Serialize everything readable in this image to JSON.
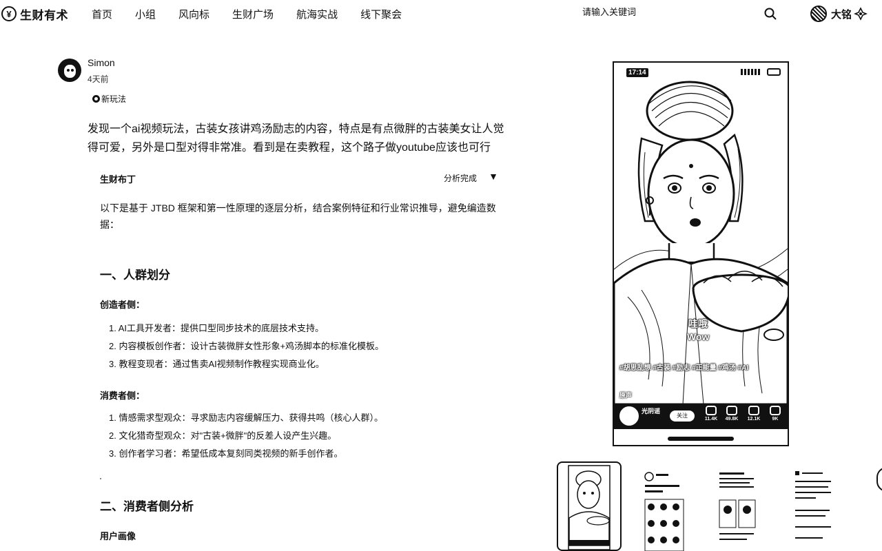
{
  "brand": {
    "logo_mark": "¥",
    "name": "生财有术"
  },
  "nav": {
    "items": [
      "首页",
      "小组",
      "风向标",
      "生财广场",
      "航海实战",
      "线下聚会"
    ]
  },
  "search": {
    "placeholder": "请输入关键词",
    "icon": "search-icon"
  },
  "user": {
    "name": "大铭",
    "avatar_icon": "user-avatar",
    "badge_icon": "brand-logo-icon"
  },
  "post": {
    "author": "Simon",
    "time": "4天前",
    "tag": "新玩法",
    "body": "发现一个ai视频玩法，古装女孩讲鸡汤励志的内容，特点是有点微胖的古装美女让人觉得可爱，另外是口型对得非常准。看到是在卖教程，这个路子做youtube应该也可行"
  },
  "ai_panel": {
    "name": "生财布丁",
    "status": "分析完成",
    "toggle_symbol": "▼",
    "intro": "以下是基于 JTBD 框架和第一性原理的逐层分析，结合案例特征和行业常识推导，避免编造数据：",
    "section1_title": "一、人群划分",
    "creator_title": "创造者侧：",
    "creator_items": [
      "1. AI工具开发者：提供口型同步技术的底层技术支持。",
      "2. 内容模板创作者：设计古装微胖女性形象+鸡汤脚本的标准化模板。",
      "3. 教程变现者：通过售卖AI视频制作教程实现商业化。"
    ],
    "consumer_title": "消费者侧：",
    "consumer_items": [
      "1. 情感需求型观众：寻求励志内容缓解压力、获得共鸣（核心人群）。",
      "2. 文化猎奇型观众：对\"古装+微胖\"的反差人设产生兴趣。",
      "3. 创作者学习者：希望低成本复刻同类视频的新手创作者。"
    ],
    "section2_title": "二、消费者侧分析",
    "persona_title": "用户画像"
  },
  "preview": {
    "status_time": "17:14",
    "caption_cn": "哇哦",
    "caption_en": "Wow",
    "description": "#胡思乱想 #古装 #励志 #正能量 #鸡汤 #AI",
    "music": "原声",
    "channel_name": "光阴谣",
    "follow_label": "关注",
    "stats": [
      "11.4K",
      "49.8K",
      "12.1K",
      "9K"
    ],
    "stat_icons": [
      "thumbs-up-icon",
      "share-icon",
      "heart-icon",
      "comment-icon"
    ]
  },
  "thumbnails": {
    "count": 4,
    "selected_index": 0
  },
  "colors": {
    "text": "#111111",
    "background": "#ffffff"
  }
}
